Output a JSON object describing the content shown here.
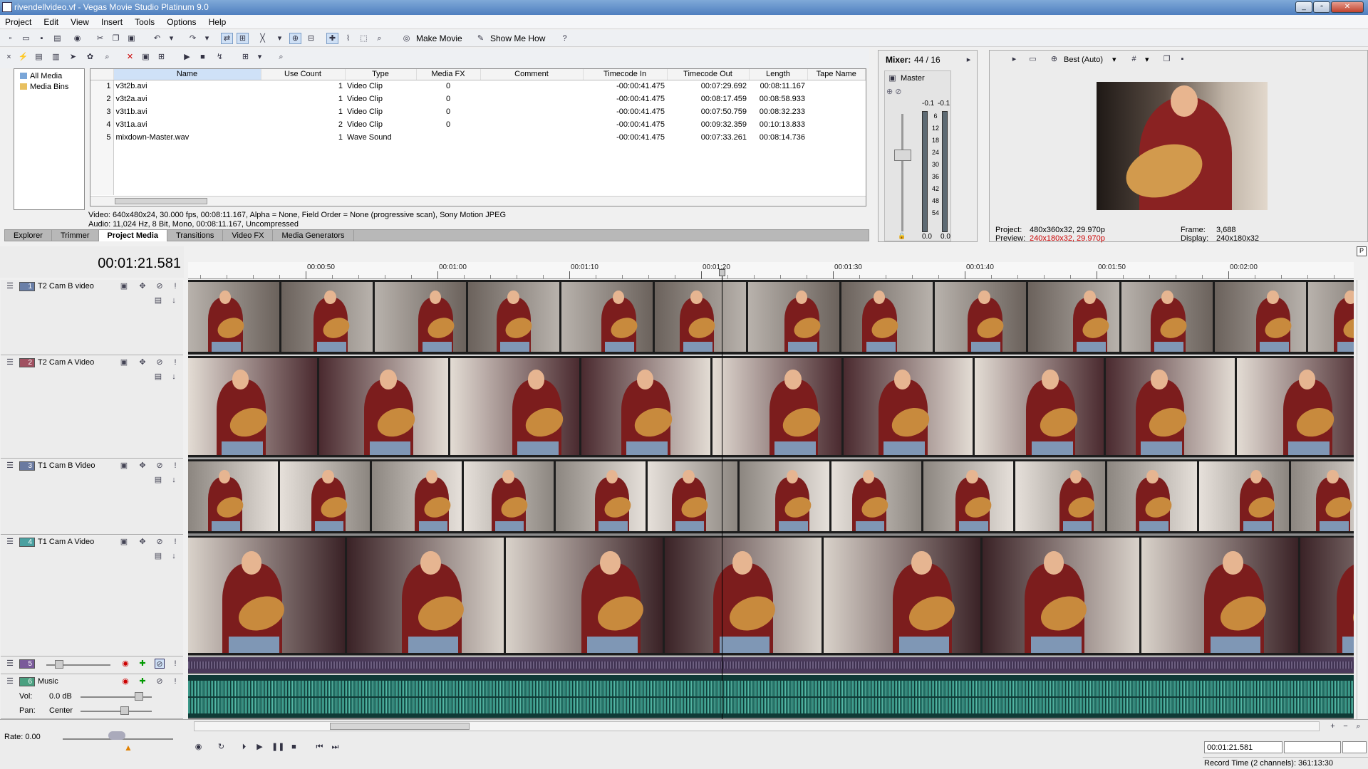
{
  "window": {
    "title": "rivendellvideo.vf - Vegas Movie Studio Platinum 9.0"
  },
  "menu": [
    "Project",
    "Edit",
    "View",
    "Insert",
    "Tools",
    "Options",
    "Help"
  ],
  "toolbar": {
    "make_movie": "Make Movie",
    "show_me_how": "Show Me How"
  },
  "explorer": {
    "tree": [
      "All Media",
      "Media Bins"
    ]
  },
  "media": {
    "columns": [
      "Name",
      "Use Count",
      "Type",
      "Media FX",
      "Comment",
      "Timecode In",
      "Timecode Out",
      "Length",
      "Tape Name"
    ],
    "rows": [
      {
        "n": "1",
        "name": "v3t2b.avi",
        "use": "1",
        "type": "Video Clip",
        "fx": "0",
        "tin": "-00:00:41.475",
        "tout": "00:07:29.692",
        "len": "00:08:11.167"
      },
      {
        "n": "2",
        "name": "v3t2a.avi",
        "use": "1",
        "type": "Video Clip",
        "fx": "0",
        "tin": "-00:00:41.475",
        "tout": "00:08:17.459",
        "len": "00:08:58.933"
      },
      {
        "n": "3",
        "name": "v3t1b.avi",
        "use": "1",
        "type": "Video Clip",
        "fx": "0",
        "tin": "-00:00:41.475",
        "tout": "00:07:50.759",
        "len": "00:08:32.233"
      },
      {
        "n": "4",
        "name": "v3t1a.avi",
        "use": "2",
        "type": "Video Clip",
        "fx": "0",
        "tin": "-00:00:41.475",
        "tout": "00:09:32.359",
        "len": "00:10:13.833"
      },
      {
        "n": "5",
        "name": "mixdown-Master.wav",
        "use": "1",
        "type": "Wave Sound",
        "fx": "",
        "tin": "-00:00:41.475",
        "tout": "00:07:33.261",
        "len": "00:08:14.736"
      }
    ],
    "info_video": "Video: 640x480x24, 30.000 fps, 00:08:11.167, Alpha = None, Field Order = None (progressive scan), Sony Motion JPEG",
    "info_audio": "Audio: 11,024 Hz, 8 Bit, Mono, 00:08:11.167, Uncompressed",
    "tabs": [
      "Explorer",
      "Trimmer",
      "Project Media",
      "Transitions",
      "Video FX",
      "Media Generators"
    ]
  },
  "mixer": {
    "title": "Mixer:",
    "count": "44 / 16",
    "master": "Master",
    "peak_l": "-0.1",
    "peak_r": "-0.1",
    "scale": [
      "6",
      "12",
      "18",
      "24",
      "30",
      "36",
      "42",
      "48",
      "54"
    ],
    "bottom_l": "0.0",
    "bottom_r": "0.0"
  },
  "preview": {
    "quality": "Best (Auto)",
    "project_label": "Project:",
    "project_val": "480x360x32, 29.970p",
    "preview_label": "Preview:",
    "preview_val": "240x180x32, 29.970p",
    "frame_label": "Frame:",
    "frame_val": "3,688",
    "display_label": "Display:",
    "display_val": "240x180x32"
  },
  "timeline": {
    "time": "00:01:21.581",
    "ruler": [
      "00:00:50",
      "00:01:00",
      "00:01:10",
      "00:01:20",
      "00:01:30",
      "00:01:40",
      "00:01:50",
      "00:02:00"
    ],
    "tracks": [
      {
        "num": "1",
        "name": "T2 Cam B video",
        "color": "#6a7fa8"
      },
      {
        "num": "2",
        "name": "T2 Cam A Video",
        "color": "#a05060"
      },
      {
        "num": "3",
        "name": "T1 Cam B Video",
        "color": "#6a7aa0"
      },
      {
        "num": "4",
        "name": "T1 Cam A Video",
        "color": "#4aa0a0"
      },
      {
        "num": "5",
        "name": "",
        "color": "#7a5a9a"
      },
      {
        "num": "6",
        "name": "Music",
        "color": "#4aa080"
      }
    ],
    "vol_label": "Vol:",
    "vol_val": "0.0 dB",
    "pan_label": "Pan:",
    "pan_val": "Center",
    "rate": "Rate: 0.00",
    "cursor_time": "00:01:21.581",
    "record_time": "Record Time (2 channels): 361:13:30"
  }
}
